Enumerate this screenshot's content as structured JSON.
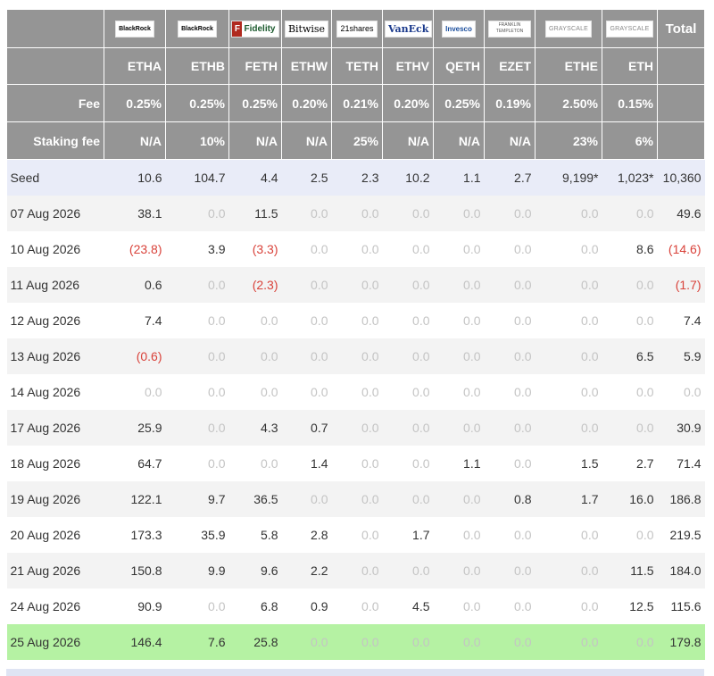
{
  "header": {
    "logos": [
      {
        "name": "blackrock-logo",
        "text": "BlackRock"
      },
      {
        "name": "blackrock-logo",
        "text": "BlackRock"
      },
      {
        "name": "fidelity-logo",
        "text": "Fidelity"
      },
      {
        "name": "bitwise-logo",
        "text": "Bitwise"
      },
      {
        "name": "21shares-logo",
        "text": "21shares"
      },
      {
        "name": "vaneck-logo",
        "text": "VanEck"
      },
      {
        "name": "invesco-logo",
        "text": "Invesco"
      },
      {
        "name": "franklin-templeton-logo",
        "text": "FRANKLIN TEMPLETON"
      },
      {
        "name": "grayscale-logo",
        "text": "GRAYSCALE"
      },
      {
        "name": "grayscale-logo",
        "text": "GRAYSCALE"
      }
    ],
    "total_label": "Total",
    "tickers": [
      "ETHA",
      "ETHB",
      "FETH",
      "ETHW",
      "TETH",
      "ETHV",
      "QETH",
      "EZET",
      "ETHE",
      "ETH"
    ],
    "fee_label": "Fee",
    "fees": [
      "0.25%",
      "0.25%",
      "0.25%",
      "0.20%",
      "0.21%",
      "0.20%",
      "0.25%",
      "0.19%",
      "2.50%",
      "0.15%"
    ],
    "staking_label": "Staking fee",
    "staking_fees": [
      "N/A",
      "10%",
      "N/A",
      "N/A",
      "25%",
      "N/A",
      "N/A",
      "N/A",
      "23%",
      "6%"
    ]
  },
  "rows": [
    {
      "date": "Seed",
      "values": [
        "10.6",
        "104.7",
        "4.4",
        "2.5",
        "2.3",
        "10.2",
        "1.1",
        "2.7",
        "9,199*",
        "1,023*",
        "10,360"
      ]
    },
    {
      "date": "07 Aug 2026",
      "values": [
        "38.1",
        "0.0",
        "11.5",
        "0.0",
        "0.0",
        "0.0",
        "0.0",
        "0.0",
        "0.0",
        "0.0",
        "49.6"
      ]
    },
    {
      "date": "10 Aug 2026",
      "values": [
        "(23.8)",
        "3.9",
        "(3.3)",
        "0.0",
        "0.0",
        "0.0",
        "0.0",
        "0.0",
        "0.0",
        "8.6",
        "(14.6)"
      ]
    },
    {
      "date": "11 Aug 2026",
      "values": [
        "0.6",
        "0.0",
        "(2.3)",
        "0.0",
        "0.0",
        "0.0",
        "0.0",
        "0.0",
        "0.0",
        "0.0",
        "(1.7)"
      ]
    },
    {
      "date": "12 Aug 2026",
      "values": [
        "7.4",
        "0.0",
        "0.0",
        "0.0",
        "0.0",
        "0.0",
        "0.0",
        "0.0",
        "0.0",
        "0.0",
        "7.4"
      ]
    },
    {
      "date": "13 Aug 2026",
      "values": [
        "(0.6)",
        "0.0",
        "0.0",
        "0.0",
        "0.0",
        "0.0",
        "0.0",
        "0.0",
        "0.0",
        "6.5",
        "5.9"
      ]
    },
    {
      "date": "14 Aug 2026",
      "values": [
        "0.0",
        "0.0",
        "0.0",
        "0.0",
        "0.0",
        "0.0",
        "0.0",
        "0.0",
        "0.0",
        "0.0",
        "0.0"
      ]
    },
    {
      "date": "17 Aug 2026",
      "values": [
        "25.9",
        "0.0",
        "4.3",
        "0.7",
        "0.0",
        "0.0",
        "0.0",
        "0.0",
        "0.0",
        "0.0",
        "30.9"
      ]
    },
    {
      "date": "18 Aug 2026",
      "values": [
        "64.7",
        "0.0",
        "0.0",
        "1.4",
        "0.0",
        "0.0",
        "1.1",
        "0.0",
        "1.5",
        "2.7",
        "71.4"
      ]
    },
    {
      "date": "19 Aug 2026",
      "values": [
        "122.1",
        "9.7",
        "36.5",
        "0.0",
        "0.0",
        "0.0",
        "0.0",
        "0.8",
        "1.7",
        "16.0",
        "186.8"
      ]
    },
    {
      "date": "20 Aug 2026",
      "values": [
        "173.3",
        "35.9",
        "5.8",
        "2.8",
        "0.0",
        "1.7",
        "0.0",
        "0.0",
        "0.0",
        "0.0",
        "219.5"
      ]
    },
    {
      "date": "21 Aug 2026",
      "values": [
        "150.8",
        "9.9",
        "9.6",
        "2.2",
        "0.0",
        "0.0",
        "0.0",
        "0.0",
        "0.0",
        "11.5",
        "184.0"
      ]
    },
    {
      "date": "24 Aug 2026",
      "values": [
        "90.9",
        "0.0",
        "6.8",
        "0.9",
        "0.0",
        "4.5",
        "0.0",
        "0.0",
        "0.0",
        "12.5",
        "115.6"
      ]
    },
    {
      "date": "25 Aug 2026",
      "values": [
        "146.4",
        "7.6",
        "25.8",
        "0.0",
        "0.0",
        "0.0",
        "0.0",
        "0.0",
        "0.0",
        "0.0",
        "179.8"
      ]
    }
  ],
  "colors": {
    "header_bg": "#959595",
    "seed_row_bg": "#e9ecf8",
    "latest_row_bg": "#b5f2a3",
    "negative": "#d9423a",
    "zero": "#c4c4c4"
  }
}
